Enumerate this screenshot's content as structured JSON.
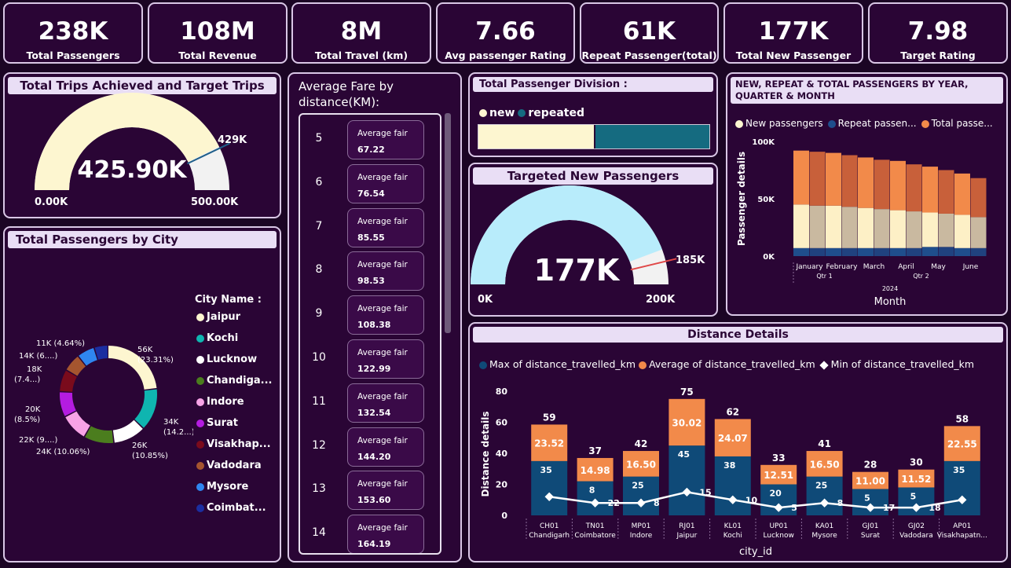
{
  "kpis": [
    {
      "value": "238K",
      "label": "Total Passengers"
    },
    {
      "value": "108M",
      "label": "Total Revenue"
    },
    {
      "value": "8M",
      "label": "Total Travel (km)"
    },
    {
      "value": "7.66",
      "label": "Avg passenger Rating"
    },
    {
      "value": "61K",
      "label": "Repeat Passenger(total)"
    },
    {
      "value": "177K",
      "label": "Total New Passenger"
    },
    {
      "value": "7.98",
      "label": "Target Rating"
    }
  ],
  "trips_gauge": {
    "title": "Total Trips Achieved and Target Trips",
    "value_label": "425.90K",
    "min_label": "0.00K",
    "max_label": "500.00K",
    "target_label": "429K",
    "min": 0,
    "max": 500,
    "value": 425.9,
    "target": 429,
    "fill_color": "#fdf6d0",
    "rest_color": "#f2f2f2",
    "target_color": "#1f5f8b"
  },
  "city_donut": {
    "title": "Total Passengers by City",
    "legend_title": "City  Name :",
    "legend": [
      {
        "name": "Jaipur",
        "color": "#fdf6d0"
      },
      {
        "name": "Kochi",
        "color": "#0fb5b0"
      },
      {
        "name": "Lucknow",
        "color": "#ffffff"
      },
      {
        "name": "Chandiga...",
        "color": "#4b7d1e"
      },
      {
        "name": "Indore",
        "color": "#f7a3e6"
      },
      {
        "name": "Surat",
        "color": "#b41ce0"
      },
      {
        "name": "Visakhap...",
        "color": "#7a0b1c"
      },
      {
        "name": "Vadodara",
        "color": "#a5552f"
      },
      {
        "name": "Mysore",
        "color": "#2f86f0"
      },
      {
        "name": "Coimbat...",
        "color": "#1b2ea0"
      }
    ],
    "slices": [
      23.31,
      14.2,
      10.85,
      10.06,
      9.2,
      8.5,
      7.4,
      6.0,
      5.9,
      4.64
    ],
    "labels": [
      {
        "l1": "56K",
        "l2": "(23.31%)"
      },
      {
        "l1": "34K",
        "l2": "(14.2...)"
      },
      {
        "l1": "26K",
        "l2": "(10.85%)"
      },
      {
        "l1": "24K (10.06%)",
        "l2": ""
      },
      {
        "l1": "22K (9....)",
        "l2": ""
      },
      {
        "l1": "20K",
        "l2": "(8.5%)"
      },
      {
        "l1": "18K",
        "l2": "(7.4...)"
      },
      {
        "l1": "14K (6....)",
        "l2": ""
      },
      {
        "l1": "11K (4.64%)",
        "l2": ""
      }
    ]
  },
  "fare": {
    "title": "Average Fare by distance(KM):",
    "item_label": "Average fair",
    "rows": [
      {
        "km": "5",
        "value": "67.22"
      },
      {
        "km": "6",
        "value": "76.54"
      },
      {
        "km": "7",
        "value": "85.55"
      },
      {
        "km": "8",
        "value": "98.53"
      },
      {
        "km": "9",
        "value": "108.38"
      },
      {
        "km": "10",
        "value": "122.99"
      },
      {
        "km": "11",
        "value": "132.54"
      },
      {
        "km": "12",
        "value": "144.20"
      },
      {
        "km": "13",
        "value": "153.60"
      },
      {
        "km": "14",
        "value": "164.19"
      }
    ]
  },
  "division": {
    "title": "Total Passenger Division :",
    "legend": [
      {
        "name": "new",
        "color": "#fdf6d0"
      },
      {
        "name": "repeated",
        "color": "#156b80"
      }
    ],
    "new_share": 0.5
  },
  "new_gauge": {
    "title": "Targeted New Passengers",
    "value_label": "177K",
    "min_label": "0K",
    "max_label": "200K",
    "target_label": "185K",
    "min": 0,
    "max": 200,
    "value": 177,
    "target": 185,
    "fill_color": "#b8ecfb",
    "rest_color": "#f2f2f2",
    "target_color": "#e04848"
  },
  "passengers_chart": {
    "title": "NEW, REPEAT & TOTAL PASSENGERS BY YEAR, QUARTER & MONTH",
    "legend": [
      {
        "name": "New passengers",
        "color": "#fdf6d0"
      },
      {
        "name": "Repeat passen...",
        "color": "#1f4e8c"
      },
      {
        "name": "Total passe...",
        "color": "#f28a4a"
      }
    ],
    "ylabel": "Passenger details",
    "xlabel": "Month",
    "yticks": [
      "100K",
      "50K",
      "0K"
    ],
    "months": [
      "January",
      "February",
      "March",
      "April",
      "May",
      "June"
    ],
    "quarters": [
      "Qtr 1",
      "Qtr 2"
    ],
    "year": "2024"
  },
  "chart_data": {
    "type": "bar",
    "title": "Distance Details",
    "xlabel": "city_id",
    "ylabel": "Distance details",
    "ylim": [
      0,
      80
    ],
    "yticks": [
      "80",
      "60",
      "40",
      "20",
      "0"
    ],
    "categories": [
      {
        "id": "CH01",
        "city": "Chandigarh"
      },
      {
        "id": "TN01",
        "city": "Coimbatore"
      },
      {
        "id": "MP01",
        "city": "Indore"
      },
      {
        "id": "RJ01",
        "city": "Jaipur"
      },
      {
        "id": "KL01",
        "city": "Kochi"
      },
      {
        "id": "UP01",
        "city": "Lucknow"
      },
      {
        "id": "KA01",
        "city": "Mysore"
      },
      {
        "id": "GJ01",
        "city": "Surat"
      },
      {
        "id": "GJ02",
        "city": "Vadodara"
      },
      {
        "id": "AP01",
        "city": "Visakhapatn..."
      }
    ],
    "series": [
      {
        "name": "Max of distance_travelled_km",
        "color": "#0f4a78",
        "values": [
          35,
          22,
          25,
          45,
          38,
          20,
          25,
          17,
          18,
          35
        ]
      },
      {
        "name": "Average of distance_travelled_km",
        "color": "#f28a4a",
        "values": [
          23.52,
          14.98,
          16.5,
          30.02,
          24.07,
          12.51,
          16.5,
          11.0,
          11.52,
          22.55
        ]
      },
      {
        "name": "Min of distance_travelled_km",
        "color": "#ffffff",
        "values": [
          12,
          8,
          8,
          15,
          10,
          5,
          8,
          5,
          5,
          10
        ]
      }
    ],
    "totals": [
      59,
      37,
      42,
      75,
      62,
      33,
      41,
      28,
      30,
      58
    ],
    "max_labels": [
      "35",
      "8",
      "25",
      "45",
      "38",
      "20",
      "25",
      "5",
      "5",
      "35"
    ],
    "avg_labels": [
      "23.52",
      "14.98",
      "16.50",
      "30.02",
      "24.07",
      "12.51",
      "16.50",
      "11.00",
      "11.52",
      "22.55"
    ],
    "min_labels": [
      "",
      "22",
      "8",
      "15",
      "10",
      "5",
      "8",
      "17",
      "18",
      ""
    ]
  }
}
